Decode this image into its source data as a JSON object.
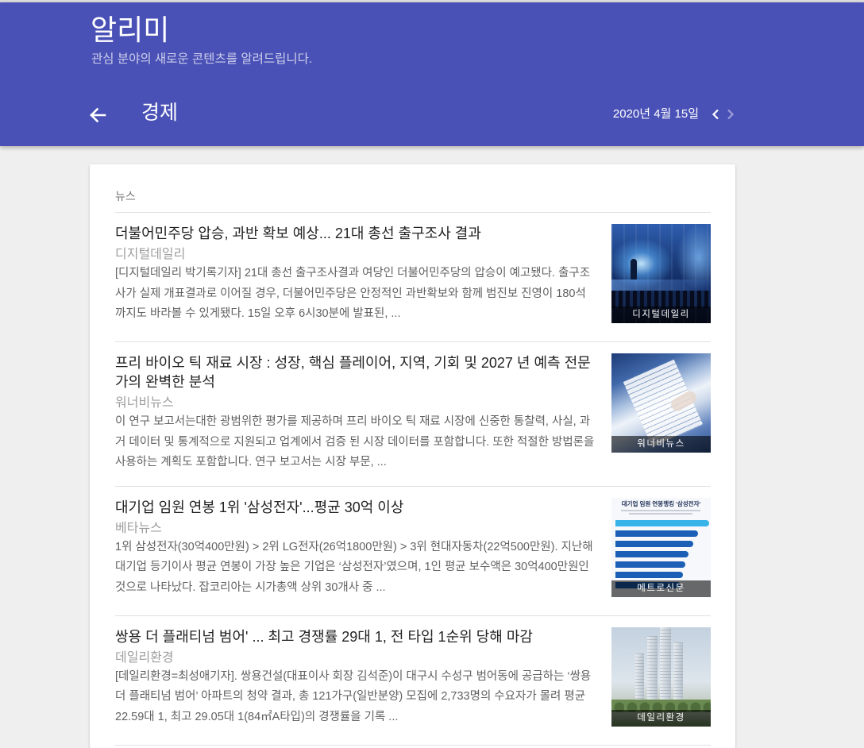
{
  "app": {
    "title": "알리미",
    "subtitle": "관심 분야의 새로운 콘텐츠를 알려드립니다."
  },
  "nav": {
    "back_icon": "arrow-back-icon",
    "topic": "경제",
    "date": "2020년 4월 15일",
    "prev_icon": "chevron-left-icon",
    "next_icon": "chevron-right-icon"
  },
  "section": {
    "label": "뉴스"
  },
  "articles": [
    {
      "title": "더불어민주당 압승, 과반 확보 예상... 21대 총선 출구조사 결과",
      "source": "디지털데일리",
      "snippet": "[디지털데일리 박기록기자] 21대 총선 출구조사결과 여당인 더불어민주당의 압승이 예고됐다. 출구조사가 실제 개표결과로 이어질 경우, 더불어민주당은 안정적인 과반확보와 함께 범진보 진영이 180석까지도 바라볼 수 있게됐다. 15일 오후 6시30분에 발표된, ...",
      "thumbnail_caption": "디지털데일리"
    },
    {
      "title": "프리 바이오 틱 재료 시장 : 성장, 핵심 플레이어, 지역, 기회 및 2027 년 예측 전문가의 완벽한 분석",
      "source": "워너비뉴스",
      "snippet": "이 연구 보고서는대한 광범위한 평가를 제공하며 프리 바이오 틱 재료 시장에 신중한 통찰력, 사실, 과거 데이터 및 통계적으로 지원되고 업계에서 검증 된 시장 데이터를 포함합니다. 또한 적절한 방법론을 사용하는 계획도 포함합니다. 연구 보고서는 시장 부문, ...",
      "thumbnail_caption": "워너비뉴스"
    },
    {
      "title": "대기업 임원 연봉 1위 '삼성전자'...평균 30억 이상",
      "source": "베타뉴스",
      "snippet": "1위 삼성전자(30억400만원) > 2위 LG전자(26억1800만원) > 3위 현대자동차(22억500만원). 지난해 대기업 등기이사 평균 연봉이 가장 높은 기업은 ‘삼성전자’였으며, 1인 평균 보수액은 30억400만원인 것으로 나타났다. 잡코리아는 시가총액 상위 30개사 중 ...",
      "thumbnail_caption": "메트로신문",
      "thumbnail_heading": "대기업 임원 연봉랭킹 '삼성전자'"
    },
    {
      "title": "쌍용 더 플래티넘 범어' ... 최고 경쟁률 29대 1, 전 타입 1순위 당해 마감",
      "source": "데일리환경",
      "snippet": "[데일리환경=최성애기자]. 쌍용건설(대표이사 회장 김석준)이 대구시 수성구 범어동에 공급하는 ‘쌍용 더 플래티넘 범어’ 아파트의 청약 결과, 총 121가구(일반분양) 모집에 2,733명의 수요자가 몰려 평균 22.59대 1, 최고 29.05대 1(84㎡A타입)의 경쟁률을 기록 ...",
      "thumbnail_caption": "데일리환경"
    }
  ],
  "colors": {
    "header_bg": "#4a51b6",
    "page_bg": "#efefef",
    "card_bg": "#ffffff",
    "title_text": "#222222",
    "source_text": "#9e9e9e",
    "snippet_text": "#616161",
    "divider": "#e0e0e0"
  }
}
